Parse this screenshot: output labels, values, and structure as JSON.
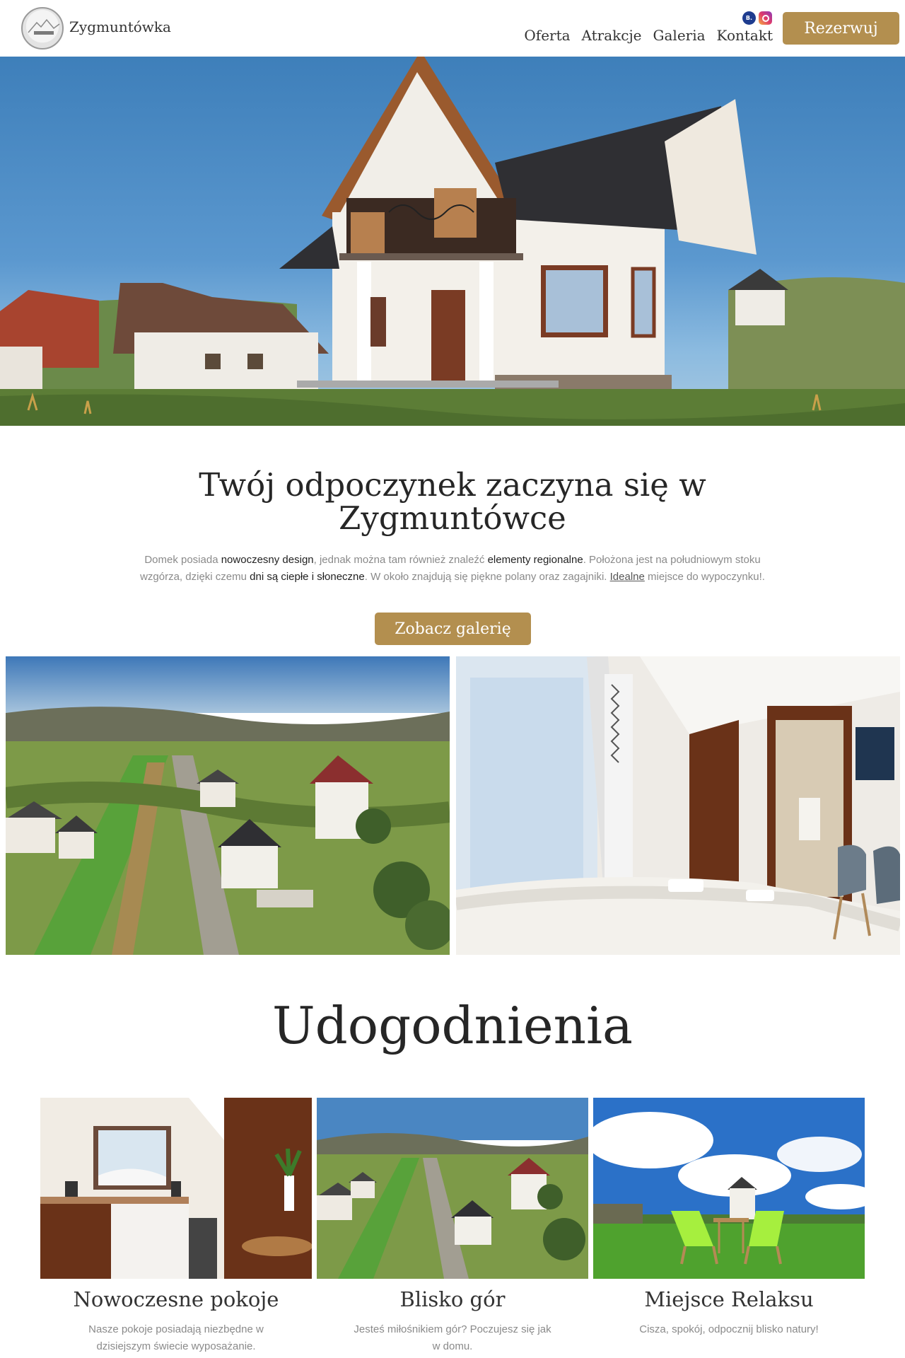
{
  "header": {
    "brand": "Zygmuntówka",
    "nav": [
      "Oferta",
      "Atrakcje",
      "Galeria",
      "Kontakt"
    ],
    "social": [
      {
        "icon": "booking-icon",
        "label": "B."
      },
      {
        "icon": "instagram-icon",
        "label": ""
      }
    ],
    "reserve_label": "Rezerwuj"
  },
  "intro": {
    "title": "Twój odpoczynek zaczyna się w Zygmuntówce",
    "text_parts": [
      {
        "text": "Domek posiada ",
        "style": "plain"
      },
      {
        "text": "nowoczesny design",
        "style": "bold"
      },
      {
        "text": ", jednak można tam również znaleźć ",
        "style": "plain"
      },
      {
        "text": "elementy regionalne",
        "style": "bold"
      },
      {
        "text": ". Położona jest na południowym stoku wzgórza, dzięki czemu ",
        "style": "plain"
      },
      {
        "text": "dni są ciepłe i słoneczne",
        "style": "bold"
      },
      {
        "text": ". W około znajdują się piękne polany oraz zagajniki. ",
        "style": "plain"
      },
      {
        "text": "Idealne",
        "style": "underline"
      },
      {
        "text": " miejsce do wypoczynku!.",
        "style": "plain"
      }
    ],
    "gallery_label": "Zobacz galerię"
  },
  "amenities": {
    "title": "Udogodnienia",
    "cards": [
      {
        "title": "Nowoczesne pokoje",
        "desc": "Nasze pokoje posiadają niezbędne w dzisiejszym świecie wyposażanie."
      },
      {
        "title": "Blisko gór",
        "desc": "Jesteś miłośnikiem gór? Poczujesz się jak w domu."
      },
      {
        "title": "Miejsce Relaksu",
        "desc": "Cisza, spokój, odpocznij blisko natury!"
      }
    ]
  },
  "colors": {
    "accent": "#b38f4f",
    "text": "#2a2a2a",
    "muted": "#8a8a8a",
    "sky": "#4a89c3"
  }
}
